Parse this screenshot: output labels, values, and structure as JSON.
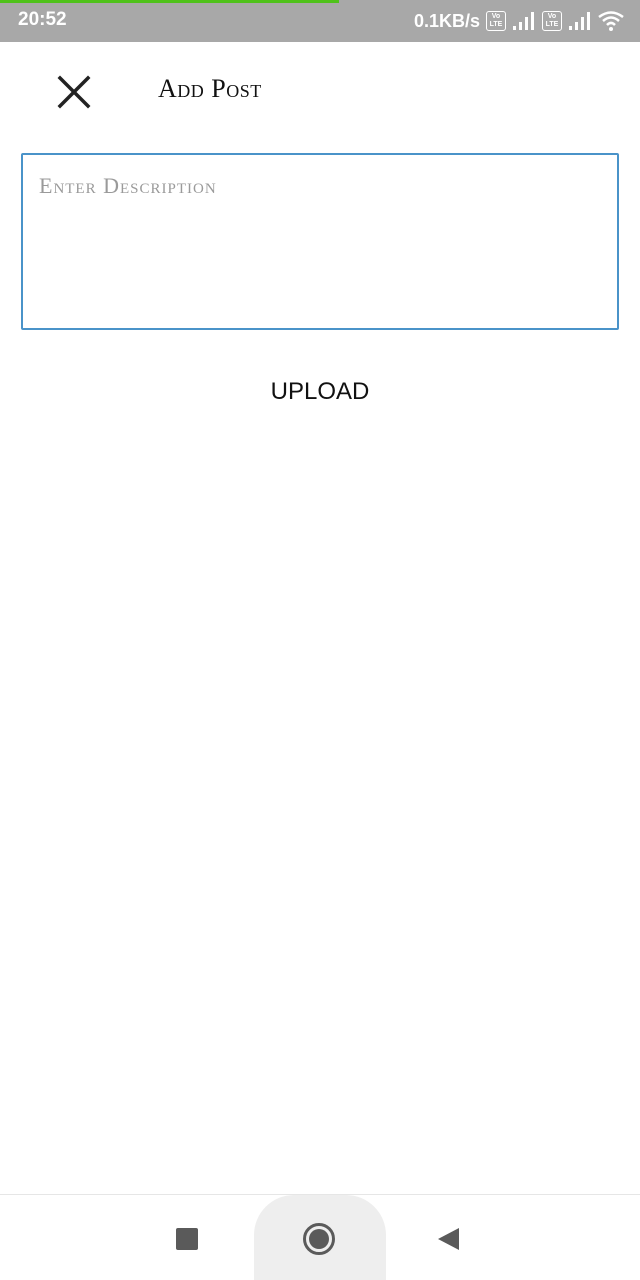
{
  "status_bar": {
    "time": "20:52",
    "network_speed": "0.1KB/s",
    "volte_badge_top": "Vo",
    "volte_badge_bottom": "LTE",
    "progress_fraction": 0.53,
    "icons": [
      "volte-icon",
      "signal-icon",
      "volte-icon",
      "signal-icon",
      "wifi-icon"
    ]
  },
  "header": {
    "close_icon": "close-icon",
    "title": "Add Post"
  },
  "form": {
    "description_value": "",
    "description_placeholder": "Enter Description",
    "upload_label": "UPLOAD"
  },
  "nav_bar": {
    "icons": [
      "recents-icon",
      "home-icon",
      "back-icon"
    ]
  },
  "colors": {
    "status_bar": "#a8a8a8",
    "progress": "#4fc21a",
    "input_border": "#4a93c9",
    "nav_icon": "#5a5a5a"
  }
}
